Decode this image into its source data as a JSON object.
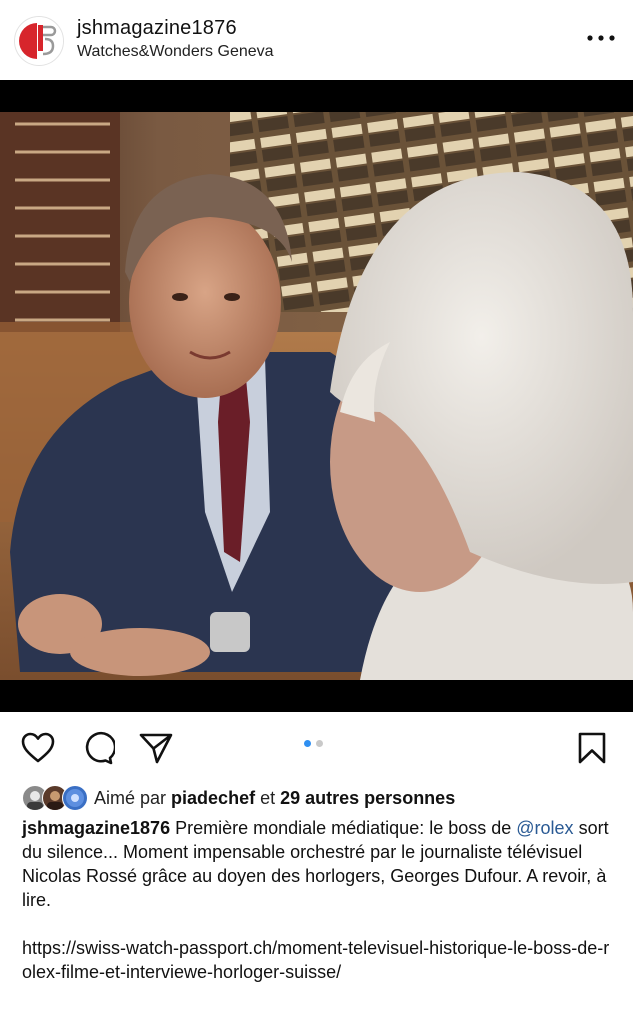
{
  "post": {
    "username": "jshmagazine1876",
    "location": "Watches&Wonders Geneva"
  },
  "carousel": {
    "total": 2,
    "current": 1
  },
  "likes": {
    "prefix": "Aimé par",
    "liker": "piadechef",
    "joiner": "et",
    "others": "29 autres personnes"
  },
  "caption": {
    "username": "jshmagazine1876",
    "text_before": " Première mondiale médiatique: le boss de ",
    "mention": "@rolex",
    "text_after": " sort du silence... Moment impensable orchestré par le journaliste télévisuel Nicolas Rossé grâce au doyen des horlogers, Georges Dufour. A revoir, à lire.",
    "link": "https://swiss-watch-passport.ch/moment-televisuel-historique-le-boss-de-rolex-filme-et-interviewe-horloger-suisse/"
  },
  "colors": {
    "accent_dot": "#2f8ff1",
    "mention": "#2a5a94",
    "logo_red": "#d7252c"
  },
  "icons": [
    "more-icon",
    "heart-icon",
    "comment-icon",
    "share-icon",
    "bookmark-icon"
  ]
}
